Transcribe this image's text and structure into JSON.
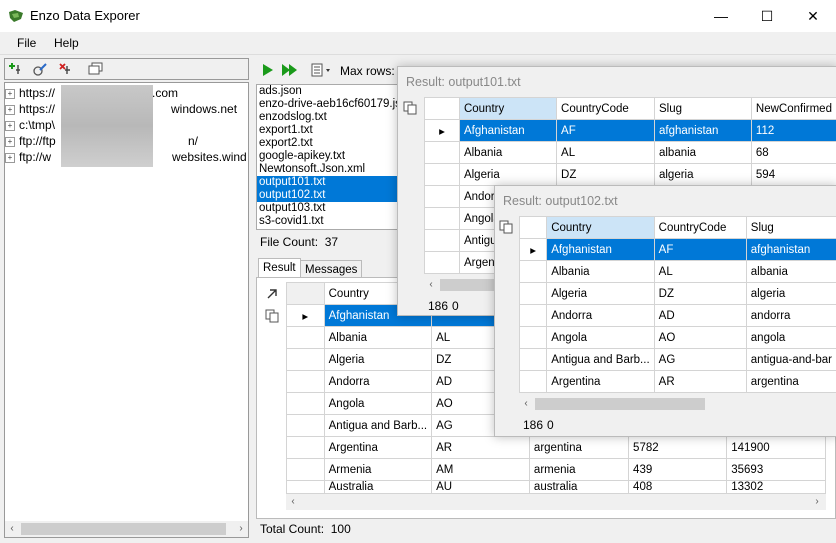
{
  "app": {
    "title": "Enzo Data Exporer"
  },
  "window_controls": {
    "minimize": "—",
    "maximize": "☐",
    "close": "✕"
  },
  "menu": {
    "file": "File",
    "help": "Help"
  },
  "tree": {
    "items": [
      {
        "label": "https://",
        "suffix": ""
      },
      {
        "label": "https://",
        "suffix": "windows.net"
      },
      {
        "label": "c:\\tmp\\",
        "suffix": ""
      },
      {
        "label": "ftp://ftp",
        "suffix": "n/"
      },
      {
        "label": "ftp://w",
        "suffix": "websites.wind"
      }
    ],
    "first_suffix": ".com"
  },
  "files_toolbar": {
    "max_rows_label": "Max rows:"
  },
  "files": {
    "items": [
      "ads.json",
      "enzo-drive-aeb16cf60179.json",
      "enzodslog.txt",
      "export1.txt",
      "export2.txt",
      "google-apikey.txt",
      "Newtonsoft.Json.xml",
      "output101.txt",
      "output102.txt",
      "output103.txt",
      "s3-covid1.txt"
    ],
    "selected": [
      "output101.txt",
      "output102.txt"
    ],
    "count_label": "File Count:",
    "count": "37"
  },
  "tabs": {
    "result": "Result",
    "messages": "Messages"
  },
  "main_grid": {
    "columns": [
      "Country",
      "",
      "",
      "",
      ""
    ],
    "rows": [
      [
        "Afghanistan",
        "",
        "",
        "",
        ""
      ],
      [
        "Albania",
        "AL",
        "",
        "",
        ""
      ],
      [
        "Algeria",
        "DZ",
        "",
        "",
        ""
      ],
      [
        "Andorra",
        "AD",
        "",
        "",
        ""
      ],
      [
        "Angola",
        "AO",
        "",
        "",
        ""
      ],
      [
        "Antigua and Barb...",
        "AG",
        "",
        "",
        ""
      ],
      [
        "Argentina",
        "AR",
        "argentina",
        "5782",
        "141900"
      ],
      [
        "Armenia",
        "AM",
        "armenia",
        "439",
        "35693"
      ],
      [
        "Australia",
        "AU",
        "australia",
        "408",
        "13302"
      ]
    ]
  },
  "status": {
    "total_count_label": "Total Count:",
    "total_count": "100"
  },
  "result1": {
    "title": "Result: output101.txt",
    "columns": [
      "Country",
      "CountryCode",
      "Slug",
      "NewConfirmed"
    ],
    "rows": [
      [
        "Afghanistan",
        "AF",
        "afghanistan",
        "112"
      ],
      [
        "Albania",
        "AL",
        "albania",
        "68"
      ],
      [
        "Algeria",
        "DZ",
        "algeria",
        "594"
      ],
      [
        "Andorra",
        "",
        "",
        ""
      ],
      [
        "Angola",
        "",
        "",
        ""
      ],
      [
        "Antigua",
        "",
        "",
        ""
      ],
      [
        "Argen",
        "",
        "",
        ""
      ]
    ],
    "status_count": "186",
    "status_zero": "0"
  },
  "result2": {
    "title": "Result: output102.txt",
    "columns": [
      "Country",
      "CountryCode",
      "Slug"
    ],
    "rows": [
      [
        "Afghanistan",
        "AF",
        "afghanistan"
      ],
      [
        "Albania",
        "AL",
        "albania"
      ],
      [
        "Algeria",
        "DZ",
        "algeria"
      ],
      [
        "Andorra",
        "AD",
        "andorra"
      ],
      [
        "Angola",
        "AO",
        "angola"
      ],
      [
        "Antigua and Barb...",
        "AG",
        "antigua-and-bar"
      ],
      [
        "Argentina",
        "AR",
        "argentina"
      ]
    ],
    "status_count": "186",
    "status_zero": "0"
  },
  "colors": {
    "selection": "#0078d7",
    "header_active": "#cce4f7",
    "play_green": "#1a9a1a"
  }
}
